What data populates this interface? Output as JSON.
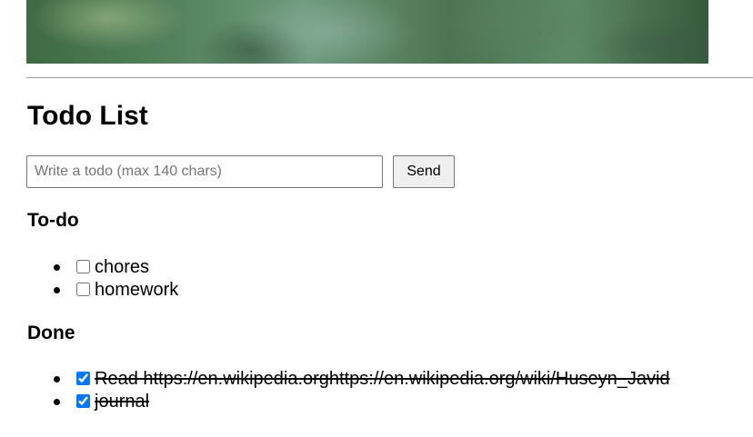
{
  "page": {
    "title": "Todo List"
  },
  "banner": {
    "image": "blurred green foliage photo"
  },
  "form": {
    "input_value": "",
    "input_placeholder": "Write a todo (max 140 chars)",
    "send_label": "Send"
  },
  "sections": {
    "todo_heading": "To-do",
    "done_heading": "Done"
  },
  "todos": [
    {
      "text": "chores",
      "checked": false
    },
    {
      "text": "homework",
      "checked": false
    }
  ],
  "done": [
    {
      "text": "Read https://en.wikipedia.orghttps://en.wikipedia.org/wiki/Huseyn_Javid",
      "checked": true
    },
    {
      "text": "journal",
      "checked": true
    }
  ],
  "colors": {
    "checkbox_accent": "#0075ff",
    "button_bg": "#efefef",
    "divider": "#9a9a9a"
  }
}
